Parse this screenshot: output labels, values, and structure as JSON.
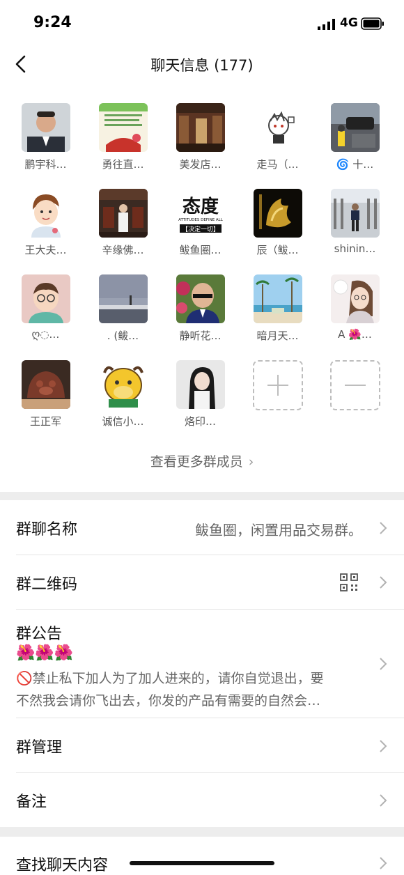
{
  "status_bar": {
    "time": "9:24",
    "network": "4G"
  },
  "header": {
    "title": "聊天信息 (177)"
  },
  "members": [
    {
      "name": "鹏宇科…"
    },
    {
      "name": "勇往直…"
    },
    {
      "name": "美发店…"
    },
    {
      "name": "走马（…"
    },
    {
      "name": "🌀 十…"
    },
    {
      "name": "王大夫…"
    },
    {
      "name": "辛缘佛…"
    },
    {
      "name": "鲅鱼圈…"
    },
    {
      "name": "辰（鲅…"
    },
    {
      "name": "shinin…"
    },
    {
      "name": "ღ◌…"
    },
    {
      "name": ". (鲅…"
    },
    {
      "name": "静听花…"
    },
    {
      "name": "暗月天…"
    },
    {
      "name": "A 🌺…"
    },
    {
      "name": "王正军"
    },
    {
      "name": "诚信小…"
    },
    {
      "name": "烙印…"
    }
  ],
  "avatar_texts": {
    "attitudes_big": "态度",
    "attitudes_small": "ATTITUDES DEFINE ALL",
    "attitudes_cn": "【决定一切】"
  },
  "view_more": "查看更多群成员",
  "settings": {
    "group_name_label": "群聊名称",
    "group_name_value": "鲅鱼圈，闲置用品交易群。",
    "qr_label": "群二维码",
    "notice_label": "群公告",
    "notice_emoji": "🌺🌺🌺",
    "notice_line1": "🚫禁止私下加人为了加人进来的，请你自觉退出，要",
    "notice_line2": "不然我会请你飞出去，你发的产品有需要的自然会…",
    "manage_label": "群管理",
    "remark_label": "备注",
    "search_label": "查找聊天内容"
  },
  "icons": {
    "back": "chevron-left-icon",
    "arrow": "chevron-right-icon",
    "qr": "qr-code-icon",
    "add": "plus-icon",
    "remove": "minus-icon",
    "signal": "cell-signal-icon",
    "battery": "battery-icon"
  }
}
